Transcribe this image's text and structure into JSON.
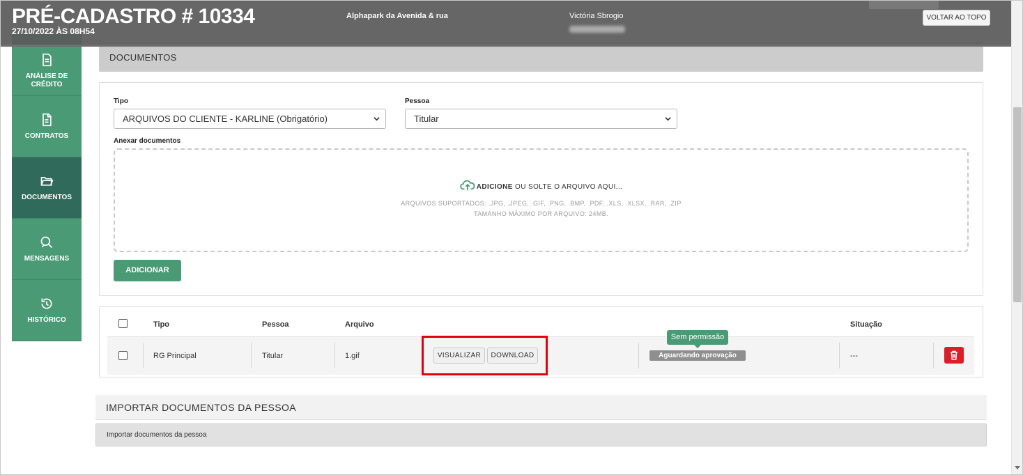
{
  "header": {
    "title": "PRÉ-CADASTRO # 10334",
    "date": "27/10/2022 ÀS 08H54",
    "venture": "Alphapark da Avenida & rua",
    "client": "Victória Sbrogio",
    "back_to_top": "VOLTAR AO TOPO"
  },
  "sidebar": {
    "items": [
      {
        "label": "ANÁLISE DE CRÉDITO",
        "icon": "document-icon",
        "active": false
      },
      {
        "label": "CONTRATOS",
        "icon": "contract-icon",
        "active": false
      },
      {
        "label": "DOCUMENTOS",
        "icon": "folder-icon",
        "active": true
      },
      {
        "label": "MENSAGENS",
        "icon": "chat-icon",
        "active": false
      },
      {
        "label": "HISTÓRICO",
        "icon": "history-icon",
        "active": false
      }
    ]
  },
  "documents": {
    "section_title": "DOCUMENTOS",
    "tipo_label": "Tipo",
    "tipo_value": "ARQUIVOS DO CLIENTE - KARLINE (Obrigatório)",
    "pessoa_label": "Pessoa",
    "pessoa_value": "Titular",
    "attach_label": "Anexar documentos",
    "dropzone": {
      "add_word": "ADICIONE",
      "rest": " OU SOLTE O ARQUIVO AQUI...",
      "supported": "ARQUIVOS SUPORTADOS: .JPG, .JPEG, .GIF, .PNG, .BMP, .PDF, .XLS, .XLSX, .RAR, .ZIP",
      "max_size": "TAMANHO MÁXIMO POR ARQUIVO: 24MB."
    },
    "add_button": "ADICIONAR"
  },
  "table": {
    "headers": {
      "tipo": "Tipo",
      "pessoa": "Pessoa",
      "arquivo": "Arquivo",
      "situacao": "Situação"
    },
    "row": {
      "tipo": "RG Principal",
      "pessoa": "Titular",
      "arquivo": "1.gif",
      "view_button": "VISUALIZAR",
      "download_button": "DOWNLOAD",
      "tooltip": "Sem permissão",
      "status_badge": "Aguardando aprovação",
      "situacao": "---"
    }
  },
  "import": {
    "title": "IMPORTAR DOCUMENTOS DA PESSOA",
    "body": "Importar documentos da pessoa"
  },
  "colors": {
    "brand_green": "#4a9a75",
    "active_sidebar": "#2f6a5a",
    "delete_red": "#dc1e2b",
    "highlight_red": "#e3000b"
  }
}
